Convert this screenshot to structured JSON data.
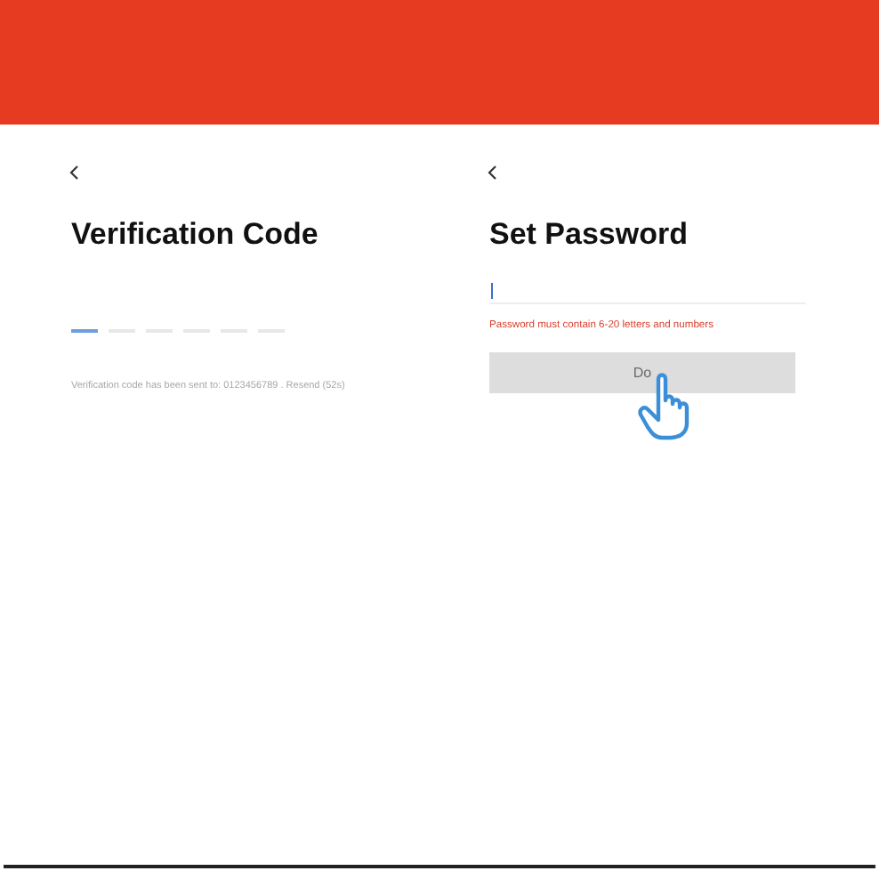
{
  "screens": [
    {
      "kind": "code",
      "title": "Verification Code",
      "code_cells": [
        {
          "selected": true
        },
        {
          "selected": false
        },
        {
          "selected": false
        },
        {
          "selected": false
        },
        {
          "selected": false
        },
        {
          "selected": false
        }
      ],
      "message": "Verification code has been sent to: 0123456789 . Resend (52s)"
    },
    {
      "kind": "password",
      "title": "Set Password",
      "password_field": {
        "focused": true
      },
      "error": "Password must contain 6-20 letters and numbers",
      "button": {
        "label": "Do",
        "disabled": true
      }
    }
  ]
}
